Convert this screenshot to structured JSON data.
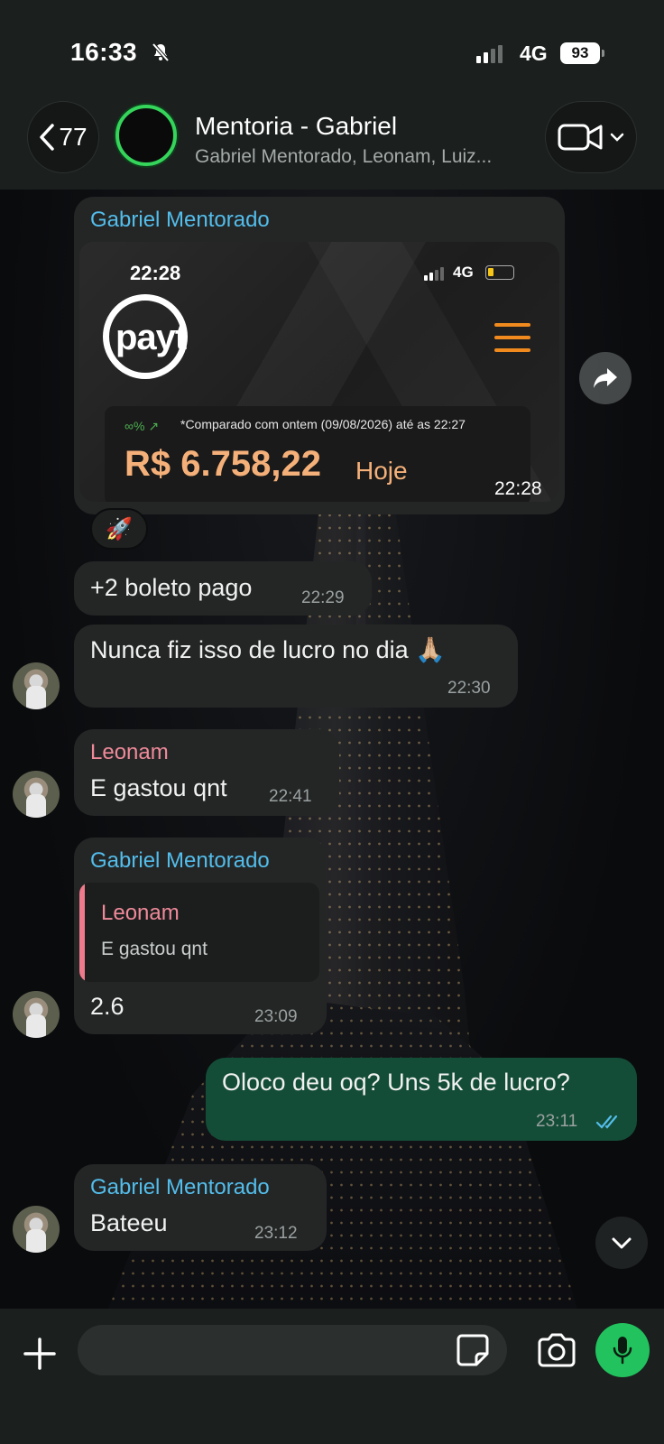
{
  "status_bar": {
    "time": "16:33",
    "network": "4G",
    "battery": "93"
  },
  "header": {
    "back_count": "77",
    "title": "Mentoria - Gabriel",
    "subtitle": "Gabriel Mentorado, Leonam, Luiz..."
  },
  "messages": [
    {
      "type": "image",
      "sender": "Gabriel Mentorado",
      "time": "22:28",
      "reaction": "🚀",
      "image": {
        "status_time": "22:28",
        "status_network": "4G",
        "brand": "payt",
        "pct_label": "∞%",
        "note": "*Comparado com ontem (09/08/2026) até as 22:27",
        "value": "R$ 6.758,22",
        "value_suffix": "Hoje"
      }
    },
    {
      "type": "text",
      "text": "+2 boleto pago",
      "time": "22:29"
    },
    {
      "type": "text",
      "text": "Nunca fiz isso de lucro no dia 🙏🏼",
      "time": "22:30"
    },
    {
      "type": "text",
      "sender": "Leonam",
      "text": "E gastou qnt",
      "time": "22:41"
    },
    {
      "type": "reply",
      "sender": "Gabriel Mentorado",
      "quoted_sender": "Leonam",
      "quoted_text": "E gastou qnt",
      "text": "2.6",
      "time": "23:09"
    },
    {
      "type": "outgoing",
      "text": "Oloco deu oq? Uns 5k de lucro?",
      "time": "23:11"
    },
    {
      "type": "text",
      "sender": "Gabriel Mentorado",
      "text": "Bateeu",
      "time": "23:12"
    }
  ],
  "composer": {
    "placeholder": ""
  },
  "colors": {
    "accent_green": "#22c35e",
    "sender_blue": "#53bdeb",
    "sender_pink": "#ef8a9a",
    "outgoing_bubble": "#144d37"
  }
}
